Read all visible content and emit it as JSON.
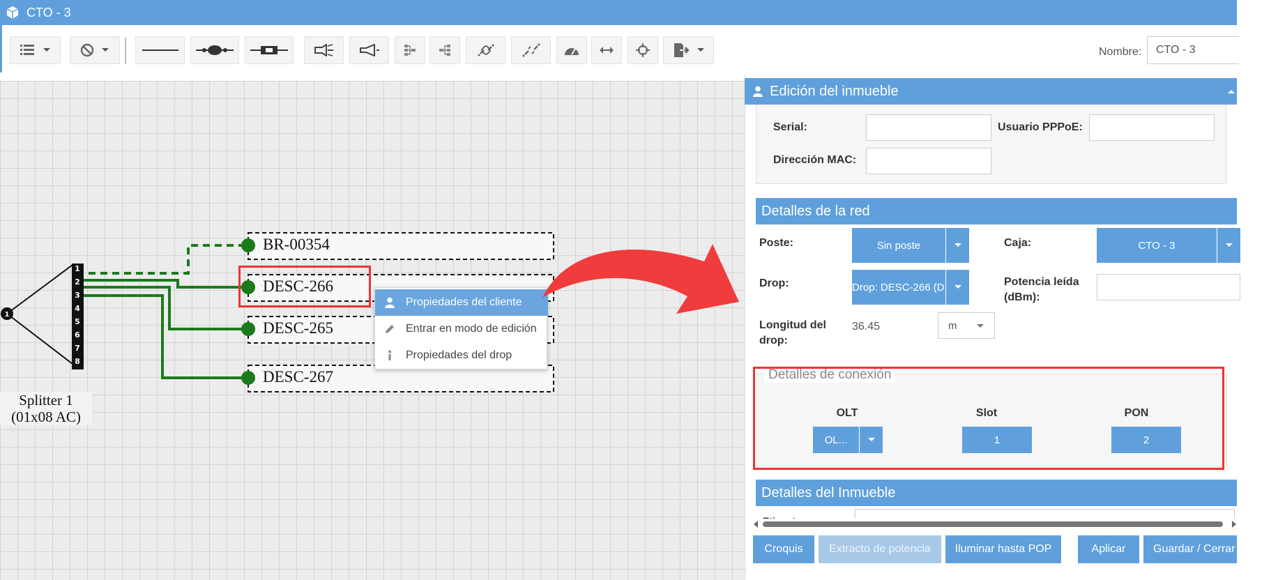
{
  "window": {
    "title": "CTO - 3",
    "icon": "cube-icon"
  },
  "toolbar": {
    "buttons": [
      "list-icon",
      "ban-icon",
      "line-icon",
      "splice-icon",
      "connector-icon",
      "flashlight-icon",
      "megaphone-icon",
      "tree-left-icon",
      "tree-right-icon",
      "link-icon",
      "unlink-icon",
      "gauge-icon",
      "arrows-horizontal-icon",
      "crosshair-icon",
      "export-icon"
    ],
    "name_label": "Nombre:",
    "name_value": "CTO - 3"
  },
  "diagram": {
    "splitter_label_line1": "Splitter 1",
    "splitter_label_line2": "(01x08 AC)",
    "splitter_input_port": "1",
    "splitter_ports": [
      "1",
      "2",
      "3",
      "4",
      "5",
      "6",
      "7",
      "8"
    ],
    "drops": [
      {
        "label": "BR-00354",
        "connection": "dashed"
      },
      {
        "label": "DESC-266",
        "connection": "solid"
      },
      {
        "label": "DESC-265",
        "connection": "solid"
      },
      {
        "label": "DESC-267",
        "connection": "solid"
      }
    ],
    "colors": {
      "fiber": "#1b7a1b",
      "highlight": "#ee3333"
    }
  },
  "context_menu": {
    "items": [
      {
        "label": "Propiedades del cliente",
        "icon": "user-icon",
        "active": true
      },
      {
        "label": "Entrar en modo de edición",
        "icon": "pencil-icon",
        "active": false
      },
      {
        "label": "Propiedades del drop",
        "icon": "info-icon",
        "active": false
      }
    ]
  },
  "panel": {
    "property_section": {
      "title": "Edición del inmueble",
      "serial_label": "Serial:",
      "serial_value": "",
      "pppoe_label": "Usuario PPPoE:",
      "pppoe_value": "",
      "mac_label": "Dirección MAC:",
      "mac_value": ""
    },
    "network_section": {
      "title": "Detalles de la red",
      "poste_label": "Poste:",
      "poste_value": "Sin poste",
      "caja_label": "Caja:",
      "caja_value": "CTO - 3",
      "drop_label": "Drop:",
      "drop_value": "Drop: DESC-266 (D...",
      "potencia_label_1": "Potencia leída",
      "potencia_label_2": "(dBm):",
      "potencia_value": "",
      "longitud_label_1": "Longitud del",
      "longitud_label_2": "drop:",
      "longitud_value": "36.45",
      "unit_value": "m"
    },
    "connection_section": {
      "title": "Detalles de conexión",
      "olt_label": "OLT",
      "olt_value": "OL...",
      "slot_label": "Slot",
      "slot_value": "1",
      "pon_label": "PON",
      "pon_value": "2"
    },
    "details_section": {
      "title": "Detalles del Inmueble",
      "partial_label": "Etiqueta"
    },
    "buttons": {
      "croquis": "Croquis",
      "extracto": "Extracto de potencia",
      "iluminar": "Iluminar hasta POP",
      "aplicar": "Aplicar",
      "guardar": "Guardar / Cerrar"
    }
  }
}
